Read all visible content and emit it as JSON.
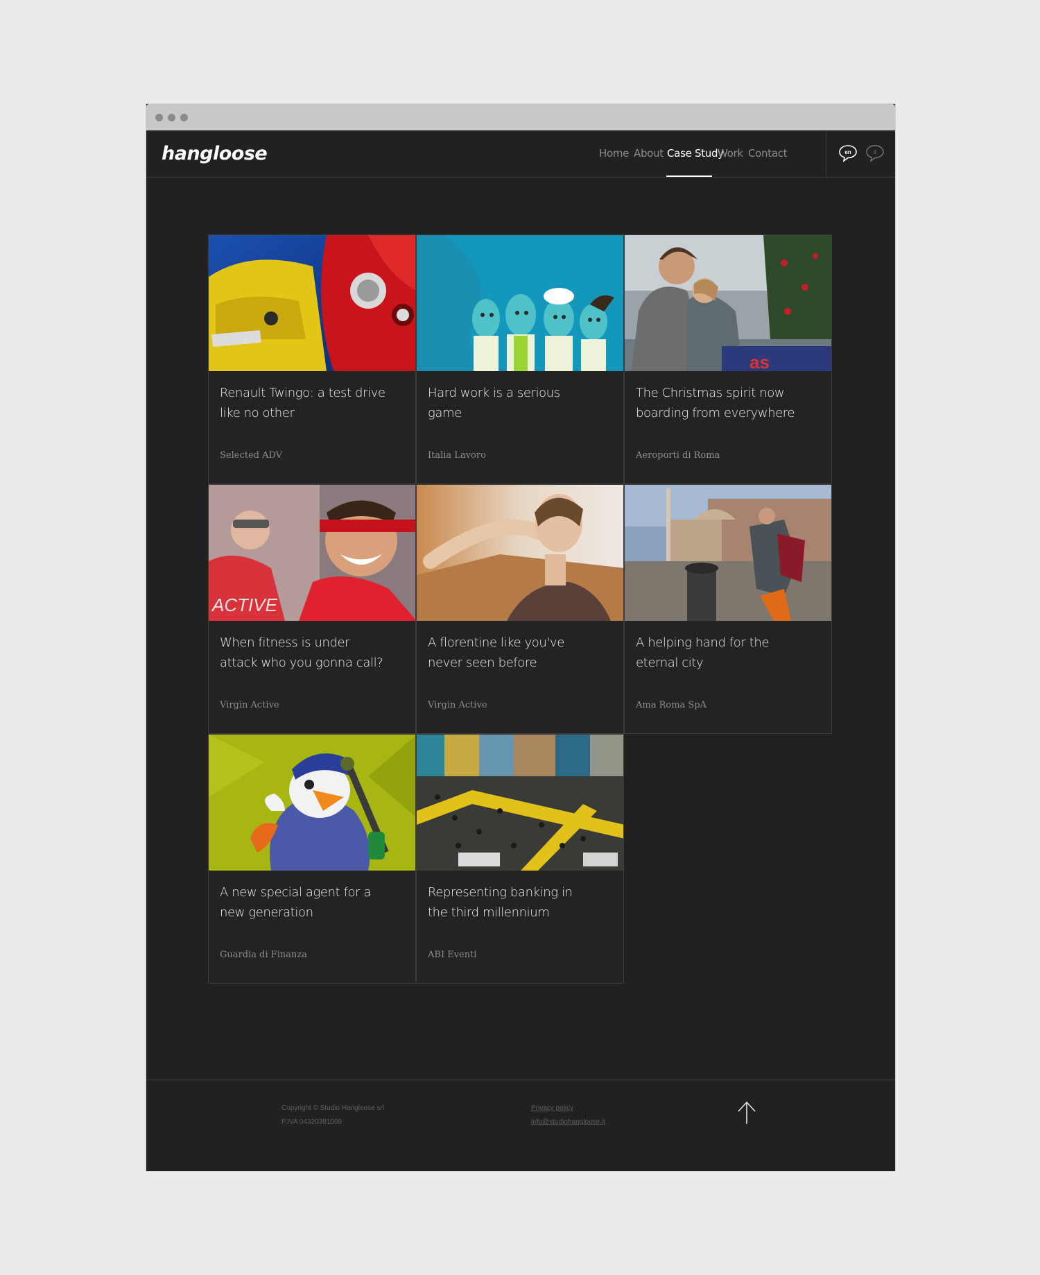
{
  "browser": {
    "dots": [
      "close",
      "minimize",
      "maximize"
    ]
  },
  "header": {
    "logo": "hangloose",
    "nav": [
      {
        "label": "Home",
        "active": false
      },
      {
        "label": "About",
        "active": false
      },
      {
        "label": "Case Study",
        "active": true
      },
      {
        "label": "Work",
        "active": false
      },
      {
        "label": "Contact",
        "active": false
      }
    ],
    "languages": [
      {
        "code": "en",
        "active": true
      },
      {
        "code": "it",
        "active": false
      }
    ]
  },
  "cases": [
    {
      "title": "Renault Twingo: a test drive like no other",
      "client": "Selected ADV",
      "image": "renault-twingo-cars"
    },
    {
      "title": "Hard work is a serious game",
      "client": "Italia Lavoro",
      "image": "cartoon-workers"
    },
    {
      "title": "The Christmas spirit now boarding from everywhere",
      "client": "Aeroporti di Roma",
      "image": "couple-airport-christmas"
    },
    {
      "title": "When fitness is under attack who you gonna call?",
      "client": "Virgin Active",
      "image": "masked-hero-fitness"
    },
    {
      "title": "A florentine like you've never seen before",
      "client": "Virgin Active",
      "image": "woman-workout"
    },
    {
      "title": "A helping hand for the eternal city",
      "client": "Ama Roma SpA",
      "image": "street-cleaner-rome"
    },
    {
      "title": "A new special agent for a new generation",
      "client": "Guardia di Finanza",
      "image": "cartoon-eagle-agent"
    },
    {
      "title": "Representing banking in the third millennium",
      "client": "ABI Eventi",
      "image": "crowded-expo-hall"
    }
  ],
  "footer": {
    "copyright": "Copyright © Studio Hangloose srl",
    "vat": "P.IVA 04320381009",
    "privacy": "Privacy policy",
    "email": "info@studiohangloose.it",
    "back_to_top_icon": "arrow-up-icon"
  }
}
